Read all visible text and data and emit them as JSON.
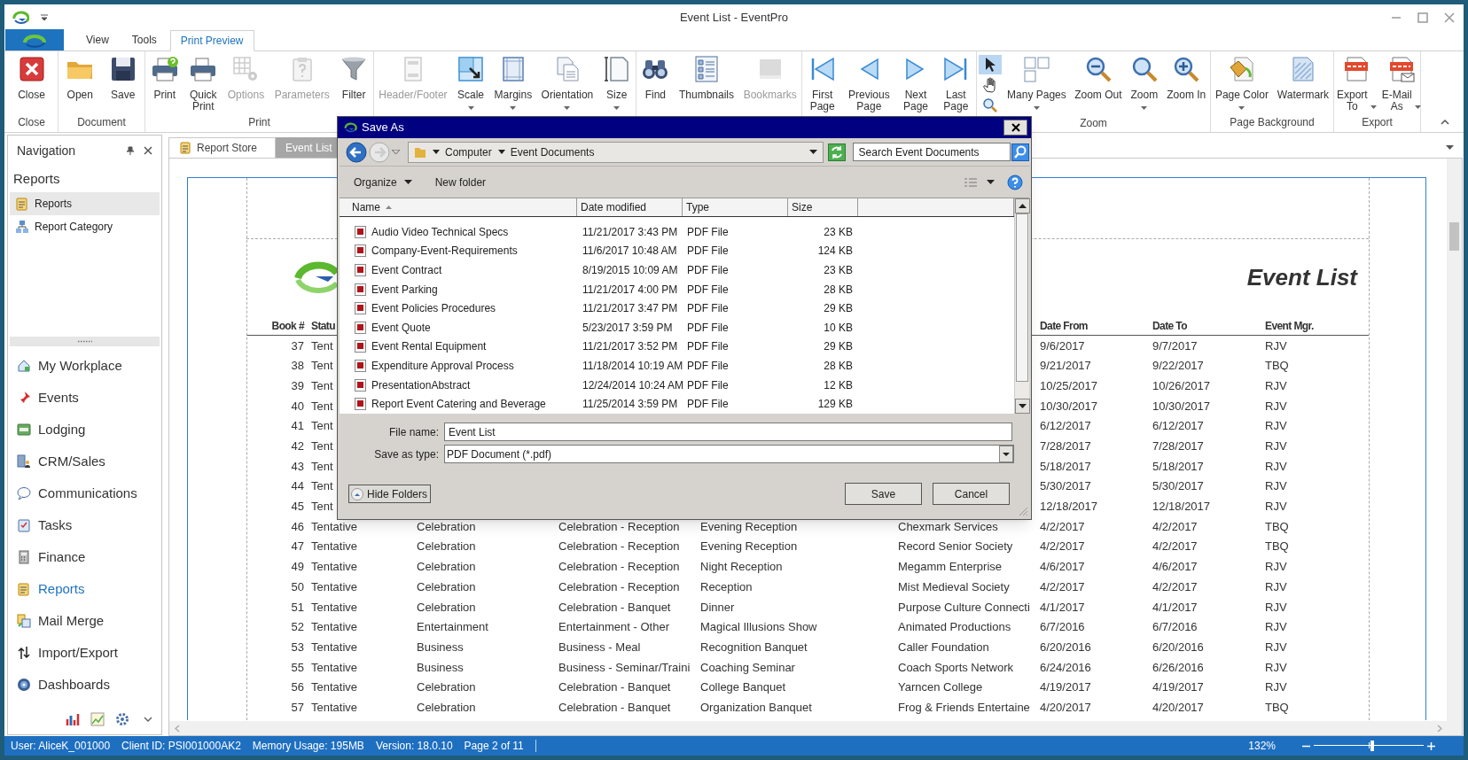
{
  "window": {
    "title": "Event List - EventPro"
  },
  "ribbon_tabs": [
    {
      "label": "View",
      "selected": false
    },
    {
      "label": "Tools",
      "selected": false
    },
    {
      "label": "Print Preview",
      "selected": true
    }
  ],
  "ribbon_groups": [
    {
      "label": "Close",
      "buttons": [
        {
          "label": "Close",
          "disabled": false
        }
      ]
    },
    {
      "label": "Document",
      "buttons": [
        {
          "label": "Open",
          "disabled": false
        },
        {
          "label": "Save",
          "disabled": false
        }
      ]
    },
    {
      "label": "Print",
      "buttons": [
        {
          "label": "Print",
          "disabled": false
        },
        {
          "label": "Quick\nPrint",
          "disabled": false
        },
        {
          "label": "Options",
          "disabled": true
        },
        {
          "label": "Parameters",
          "disabled": true
        },
        {
          "label": "Filter",
          "disabled": false
        }
      ]
    },
    {
      "buttons": [
        {
          "label": "Header/Footer",
          "disabled": true
        },
        {
          "kind": "dropdown",
          "label": "Scale",
          "disabled": false
        },
        {
          "kind": "dropdown",
          "label": "Margins",
          "disabled": false
        },
        {
          "kind": "dropdown",
          "label": "Orientation",
          "disabled": false
        },
        {
          "kind": "dropdown",
          "label": "Size",
          "disabled": false
        }
      ]
    },
    {
      "buttons": [
        {
          "label": "Find",
          "disabled": false
        },
        {
          "label": "Thumbnails",
          "disabled": false
        },
        {
          "label": "Bookmarks",
          "disabled": true
        }
      ]
    },
    {
      "buttons": [
        {
          "label": "First\nPage",
          "disabled": false
        },
        {
          "label": "Previous\nPage",
          "disabled": false
        },
        {
          "label": "Next\nPage",
          "disabled": false
        },
        {
          "label": "Last\nPage",
          "disabled": false
        }
      ]
    },
    {
      "label": "Zoom",
      "buttons": [
        {
          "kind": "tools",
          "tools": [
            {
              "selected": true
            },
            {
              "selected": false
            },
            {
              "selected": false
            }
          ]
        },
        {
          "kind": "dropdown",
          "label": "Many Pages",
          "disabled": false
        },
        {
          "label": "Zoom Out",
          "disabled": false
        },
        {
          "kind": "dropdown",
          "label": "Zoom",
          "disabled": false
        },
        {
          "label": "Zoom In",
          "disabled": false
        }
      ]
    },
    {
      "label": "Page Background",
      "buttons": [
        {
          "kind": "dropdown",
          "label": "Page Color",
          "disabled": false
        },
        {
          "label": "Watermark",
          "disabled": false
        }
      ]
    },
    {
      "label": "Export",
      "buttons": [
        {
          "kind": "inline-dropdown",
          "label": "Export\nTo",
          "disabled": false
        },
        {
          "kind": "inline-dropdown",
          "label": "E-Mail\nAs",
          "disabled": false
        }
      ]
    }
  ],
  "navigation": {
    "title": "Navigation",
    "section": "Reports",
    "items": [
      {
        "label": "Reports",
        "selected": true
      },
      {
        "label": "Report Category",
        "selected": false
      }
    ],
    "modules": [
      {
        "label": "My Workplace",
        "selected": false
      },
      {
        "label": "Events",
        "selected": false
      },
      {
        "label": "Lodging",
        "selected": false
      },
      {
        "label": "CRM/Sales",
        "selected": false
      },
      {
        "label": "Communications",
        "selected": false
      },
      {
        "label": "Tasks",
        "selected": false
      },
      {
        "label": "Finance",
        "selected": false
      },
      {
        "label": "Reports",
        "selected": true
      },
      {
        "label": "Mail Merge",
        "selected": false
      },
      {
        "label": "Import/Export",
        "selected": false
      },
      {
        "label": "Dashboards",
        "selected": false
      }
    ]
  },
  "document_tabs": [
    {
      "label": "Report Store",
      "selected": false
    },
    {
      "label": "Event List",
      "selected": true
    }
  ],
  "report": {
    "title": "Event List",
    "headers": {
      "book": "Book #",
      "status": "Statu",
      "date_from": "Date From",
      "date_to": "Date To",
      "manager": "Event Mgr."
    },
    "rows": [
      {
        "book": "37",
        "status": "Tent",
        "date_from": "9/6/2017",
        "date_to": "9/7/2017",
        "manager": "RJV"
      },
      {
        "book": "38",
        "status": "Tent",
        "date_from": "9/21/2017",
        "date_to": "9/22/2017",
        "manager": "TBQ"
      },
      {
        "book": "39",
        "status": "Tent",
        "date_from": "10/25/2017",
        "date_to": "10/26/2017",
        "manager": "RJV"
      },
      {
        "book": "40",
        "status": "Tent",
        "date_from": "10/30/2017",
        "date_to": "10/30/2017",
        "manager": "RJV"
      },
      {
        "book": "41",
        "status": "Tent",
        "date_from": "6/12/2017",
        "date_to": "6/12/2017",
        "manager": "RJV"
      },
      {
        "book": "42",
        "status": "Tent",
        "date_from": "7/28/2017",
        "date_to": "7/28/2017",
        "manager": "RJV"
      },
      {
        "book": "43",
        "status": "Tent",
        "date_from": "5/18/2017",
        "date_to": "5/18/2017",
        "manager": "RJV"
      },
      {
        "book": "44",
        "status": "Tent",
        "date_from": "5/30/2017",
        "date_to": "5/30/2017",
        "manager": "RJV"
      },
      {
        "book": "45",
        "status": "Tent",
        "date_from": "12/18/2017",
        "date_to": "12/18/2017",
        "manager": "RJV"
      },
      {
        "book": "46",
        "status": "Tentative",
        "column_3": "Celebration",
        "column_4": "Celebration - Reception",
        "column_5": "Evening Reception",
        "column_6": "Chexmark Services",
        "date_from": "4/2/2017",
        "date_to": "4/2/2017",
        "manager": "TBQ"
      },
      {
        "book": "47",
        "status": "Tentative",
        "column_3": "Celebration",
        "column_4": "Celebration - Reception",
        "column_5": "Evening Reception",
        "column_6": "Record Senior Society",
        "date_from": "4/2/2017",
        "date_to": "4/2/2017",
        "manager": "TBQ"
      },
      {
        "book": "49",
        "status": "Tentative",
        "column_3": "Celebration",
        "column_4": "Celebration - Reception",
        "column_5": "Night Reception",
        "column_6": "Megamm Enterprise",
        "date_from": "4/6/2017",
        "date_to": "4/6/2017",
        "manager": "RJV"
      },
      {
        "book": "50",
        "status": "Tentative",
        "column_3": "Celebration",
        "column_4": "Celebration - Reception",
        "column_5": "Reception",
        "column_6": "Mist Medieval Society",
        "date_from": "4/2/2017",
        "date_to": "4/2/2017",
        "manager": "RJV"
      },
      {
        "book": "51",
        "status": "Tentative",
        "column_3": "Celebration",
        "column_4": "Celebration - Banquet",
        "column_5": "Dinner",
        "column_6": "Purpose Culture Connecti",
        "date_from": "4/1/2017",
        "date_to": "4/1/2017",
        "manager": "RJV"
      },
      {
        "book": "52",
        "status": "Tentative",
        "column_3": "Entertainment",
        "column_4": "Entertainment - Other",
        "column_5": "Magical Illusions Show",
        "column_6": "Animated Productions",
        "date_from": "6/7/2016",
        "date_to": "6/7/2016",
        "manager": "RJV"
      },
      {
        "book": "53",
        "status": "Tentative",
        "column_3": "Business",
        "column_4": "Business - Meal",
        "column_5": "Recognition Banquet",
        "column_6": "Caller Foundation",
        "date_from": "6/20/2016",
        "date_to": "6/20/2016",
        "manager": "RJV"
      },
      {
        "book": "55",
        "status": "Tentative",
        "column_3": "Business",
        "column_4": "Business - Seminar/Traini",
        "column_5": "Coaching Seminar",
        "column_6": "Coach Sports Network",
        "date_from": "6/24/2016",
        "date_to": "6/26/2016",
        "manager": "RJV"
      },
      {
        "book": "56",
        "status": "Tentative",
        "column_3": "Celebration",
        "column_4": "Celebration - Banquet",
        "column_5": "College Banquet",
        "column_6": "Yarncen College",
        "date_from": "4/19/2017",
        "date_to": "4/19/2017",
        "manager": "RJV"
      },
      {
        "book": "57",
        "status": "Tentative",
        "column_3": "Celebration",
        "column_4": "Celebration - Banquet",
        "column_5": "Organization Banquet",
        "column_6": "Frog & Friends Entertaine",
        "date_from": "4/20/2017",
        "date_to": "4/20/2017",
        "manager": "TBQ"
      }
    ]
  },
  "save_dialog": {
    "title": "Save As",
    "breadcrumb": [
      "Computer",
      "Event Documents"
    ],
    "search": {
      "placeholder": "Search Event Documents"
    },
    "organize": "Organize",
    "new_folder": "New folder",
    "columns": [
      {
        "label": "Name",
        "sorted": true
      },
      {
        "label": "Date modified",
        "sorted": false
      },
      {
        "label": "Type",
        "sorted": false
      },
      {
        "label": "Size",
        "sorted": false
      }
    ],
    "files": [
      {
        "name": "Audio Video Technical Specs",
        "date": "11/21/2017 3:43 PM",
        "type": "PDF File",
        "size": "23 KB"
      },
      {
        "name": "Company-Event-Requirements",
        "date": "11/6/2017 10:48 AM",
        "type": "PDF File",
        "size": "124 KB"
      },
      {
        "name": "Event Contract",
        "date": "8/19/2015 10:09 AM",
        "type": "PDF File",
        "size": "23 KB"
      },
      {
        "name": "Event Parking",
        "date": "11/21/2017 4:00 PM",
        "type": "PDF File",
        "size": "28 KB"
      },
      {
        "name": "Event Policies Procedures",
        "date": "11/21/2017 3:47 PM",
        "type": "PDF File",
        "size": "29 KB"
      },
      {
        "name": "Event Quote",
        "date": "5/23/2017 3:59 PM",
        "type": "PDF File",
        "size": "10 KB"
      },
      {
        "name": "Event Rental Equipment",
        "date": "11/21/2017 3:52 PM",
        "type": "PDF File",
        "size": "29 KB"
      },
      {
        "name": "Expenditure Approval Process",
        "date": "11/18/2014 10:19 AM",
        "type": "PDF File",
        "size": "28 KB"
      },
      {
        "name": "PresentationAbstract",
        "date": "12/24/2014 10:24 AM",
        "type": "PDF File",
        "size": "12 KB"
      },
      {
        "name": "Report Event Catering and Beverage",
        "date": "11/25/2014 3:59 PM",
        "type": "PDF File",
        "size": "129 KB"
      }
    ],
    "file_name": {
      "label": "File name:",
      "value": "Event List"
    },
    "save_as_type": {
      "label": "Save as type:",
      "value": "PDF Document (*.pdf)"
    },
    "hide_folders": "Hide Folders",
    "buttons": [
      "Save",
      "Cancel"
    ]
  },
  "status_bar": {
    "items": [
      "User: AliceK_001000",
      "Client ID: PSI001000AK2",
      "Memory Usage: 195MB",
      "Version: 18.0.10",
      "Page 2 of 11"
    ],
    "zoom": {
      "reading": "132%",
      "level": 0.53
    }
  }
}
